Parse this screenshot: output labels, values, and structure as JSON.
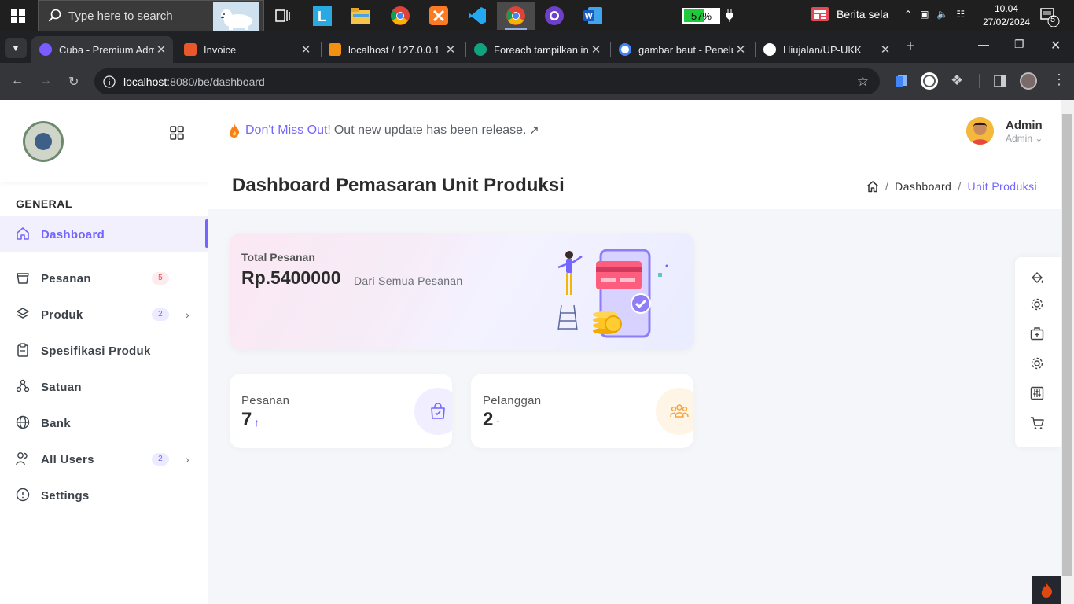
{
  "taskbar": {
    "search_placeholder": "Type here to search",
    "battery_percent": "57%",
    "battery_level": 0.57,
    "news": "Berita sela",
    "time": "10.04",
    "date": "27/02/2024",
    "notification_count": "5"
  },
  "browser": {
    "tabs": [
      {
        "title": "Cuba - Premium Adm",
        "active": true,
        "favicon_color": "#7b5cff"
      },
      {
        "title": "Invoice",
        "active": false,
        "favicon_color": "#e8582a"
      },
      {
        "title": "localhost / 127.0.0.1 /",
        "active": false,
        "favicon_color": "#f29111"
      },
      {
        "title": "Foreach tampilkan in",
        "active": false,
        "favicon_color": "#10a37f"
      },
      {
        "title": "gambar baut - Penelu",
        "active": false,
        "favicon_color": "#4285f4"
      },
      {
        "title": "Hiujalan/UP-UKK",
        "active": false,
        "favicon_color": "#ffffff"
      }
    ],
    "url_host": "localhost",
    "url_rest": ":8080/be/dashboard"
  },
  "sidebar": {
    "section_label": "GENERAL",
    "items": [
      {
        "label": "Dashboard",
        "icon": "home-icon",
        "active": true
      },
      {
        "label": "Pesanan",
        "icon": "basket-icon",
        "badge": "5",
        "badge_type": "red"
      },
      {
        "label": "Produk",
        "icon": "layers-icon",
        "badge": "2",
        "badge_type": "blue",
        "chevron": true
      },
      {
        "label": "Spesifikasi Produk",
        "icon": "clipboard-icon"
      },
      {
        "label": "Satuan",
        "icon": "nodes-icon"
      },
      {
        "label": "Bank",
        "icon": "globe-icon"
      },
      {
        "label": "All Users",
        "icon": "users-icon",
        "badge": "2",
        "badge_type": "blue",
        "chevron": true
      },
      {
        "label": "Settings",
        "icon": "info-icon"
      }
    ]
  },
  "header": {
    "notice_highlight": "Don't Miss Out!",
    "notice_text": "Out new update has been release.",
    "user_name": "Admin",
    "user_role": "Admin"
  },
  "page": {
    "title": "Dashboard Pemasaran Unit Produksi",
    "breadcrumb": [
      "Dashboard",
      "Unit Produksi"
    ]
  },
  "hero": {
    "label": "Total Pesanan",
    "value": "Rp.5400000",
    "sub": "Dari Semua Pesanan"
  },
  "stats": [
    {
      "label": "Pesanan",
      "value": "7",
      "color": "#7366ff",
      "icon": "bag-check-icon"
    },
    {
      "label": "Pelanggan",
      "value": "2",
      "color": "#f7a13b",
      "icon": "group-icon"
    }
  ],
  "colors": {
    "accent": "#7366ff",
    "warning": "#f7a13b",
    "danger": "#fc4438"
  }
}
